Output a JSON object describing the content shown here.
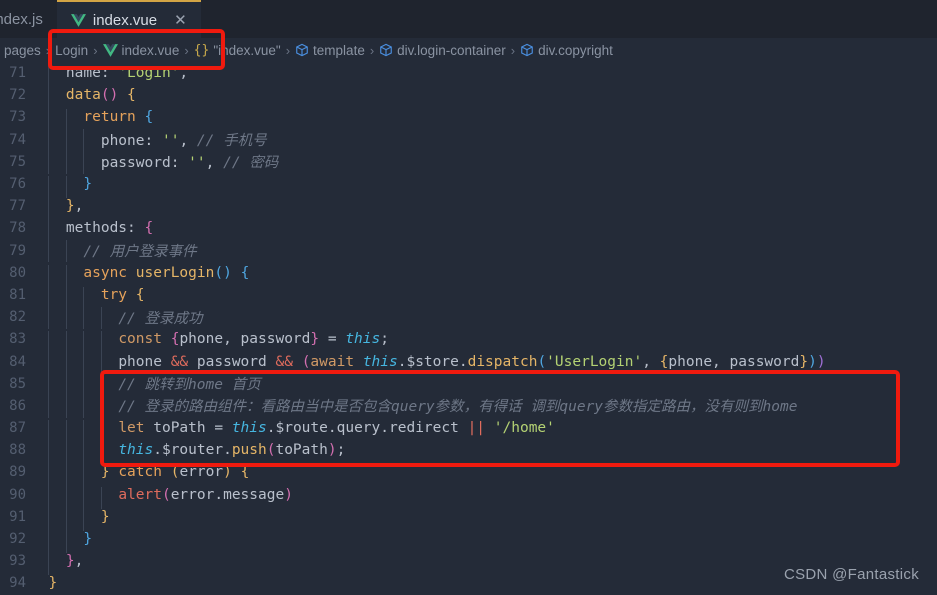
{
  "colors": {
    "editor_background": "#242b38",
    "tabbar_background": "#1f242e",
    "active_tab_accent": "#d3a545",
    "annotation_red": "#f01a0e",
    "gutter_text": "#545e70",
    "comment": "#6e7787",
    "string": "#b4d273",
    "keyword": "#c678dd",
    "vue_green": "#42b883",
    "vue_dark_green": "#35495e",
    "breadcrumb_icon_blue": "#4a8fe0"
  },
  "tabbar": {
    "tabs": [
      {
        "label": "index.js",
        "icon": "javascript-file-icon",
        "active": false,
        "closable": false
      },
      {
        "label": "index.vue",
        "icon": "vue-file-icon",
        "active": true,
        "closable": true,
        "close_glyph": "✕"
      }
    ]
  },
  "breadcrumb": {
    "items": [
      {
        "label": "pages",
        "icon": ""
      },
      {
        "label": "Login",
        "icon": ""
      },
      {
        "label": "index.vue",
        "icon": "vue-file-icon"
      },
      {
        "label": "\"index.vue\"",
        "icon": "braces-icon",
        "braces": "{}"
      },
      {
        "label": "template",
        "icon": "cube-icon"
      },
      {
        "label": "div.login-container",
        "icon": "cube-icon"
      },
      {
        "label": "div.copyright",
        "icon": "cube-icon"
      }
    ],
    "separator": "›"
  },
  "editor": {
    "first_line": 71,
    "lines": [
      {
        "n": "71",
        "indent": 2,
        "tokens": [
          {
            "t": "name",
            "c": "t-prop"
          },
          {
            "t": ": ",
            "c": "t-punc"
          },
          {
            "t": "'Login'",
            "c": "t-str"
          },
          {
            "t": ",",
            "c": "t-punc"
          }
        ]
      },
      {
        "n": "72",
        "indent": 2,
        "tokens": [
          {
            "t": "data",
            "c": "t-fn"
          },
          {
            "t": "()",
            "c": "t-brace-p"
          },
          {
            "t": " ",
            "c": "t-punc"
          },
          {
            "t": "{",
            "c": "t-brace-y"
          }
        ]
      },
      {
        "n": "73",
        "indent": 3,
        "tokens": [
          {
            "t": "return",
            "c": "t-kw2"
          },
          {
            "t": " ",
            "c": "t-punc"
          },
          {
            "t": "{",
            "c": "t-brace-b"
          }
        ]
      },
      {
        "n": "74",
        "indent": 4,
        "tokens": [
          {
            "t": "phone",
            "c": "t-prop"
          },
          {
            "t": ": ",
            "c": "t-punc"
          },
          {
            "t": "''",
            "c": "t-str"
          },
          {
            "t": ", ",
            "c": "t-punc"
          },
          {
            "t": "// 手机号",
            "c": "t-com"
          }
        ]
      },
      {
        "n": "75",
        "indent": 4,
        "tokens": [
          {
            "t": "password",
            "c": "t-prop"
          },
          {
            "t": ": ",
            "c": "t-punc"
          },
          {
            "t": "''",
            "c": "t-str"
          },
          {
            "t": ", ",
            "c": "t-punc"
          },
          {
            "t": "// 密码",
            "c": "t-com"
          }
        ]
      },
      {
        "n": "76",
        "indent": 3,
        "tokens": [
          {
            "t": "}",
            "c": "t-brace-b"
          }
        ]
      },
      {
        "n": "77",
        "indent": 2,
        "tokens": [
          {
            "t": "}",
            "c": "t-brace-y"
          },
          {
            "t": ",",
            "c": "t-punc"
          }
        ]
      },
      {
        "n": "78",
        "indent": 2,
        "tokens": [
          {
            "t": "methods",
            "c": "t-prop"
          },
          {
            "t": ": ",
            "c": "t-punc"
          },
          {
            "t": "{",
            "c": "t-brace-p"
          }
        ]
      },
      {
        "n": "79",
        "indent": 3,
        "tokens": [
          {
            "t": "// 用户登录事件",
            "c": "t-com"
          }
        ]
      },
      {
        "n": "80",
        "indent": 3,
        "tokens": [
          {
            "t": "async",
            "c": "t-kw2"
          },
          {
            "t": " ",
            "c": "t-punc"
          },
          {
            "t": "userLogin",
            "c": "t-fn"
          },
          {
            "t": "()",
            "c": "t-brace-b"
          },
          {
            "t": " ",
            "c": "t-punc"
          },
          {
            "t": "{",
            "c": "t-brace-b"
          }
        ]
      },
      {
        "n": "81",
        "indent": 4,
        "tokens": [
          {
            "t": "try",
            "c": "t-kw2"
          },
          {
            "t": " ",
            "c": "t-punc"
          },
          {
            "t": "{",
            "c": "t-brace-y"
          }
        ]
      },
      {
        "n": "82",
        "indent": 5,
        "tokens": [
          {
            "t": "// 登录成功",
            "c": "t-com"
          }
        ]
      },
      {
        "n": "83",
        "indent": 5,
        "tokens": [
          {
            "t": "const",
            "c": "t-var"
          },
          {
            "t": " ",
            "c": "t-punc"
          },
          {
            "t": "{",
            "c": "t-brace-p"
          },
          {
            "t": "phone, password",
            "c": "t-prop"
          },
          {
            "t": "}",
            "c": "t-brace-p"
          },
          {
            "t": " = ",
            "c": "t-punc"
          },
          {
            "t": "this",
            "c": "t-this"
          },
          {
            "t": ";",
            "c": "t-punc"
          }
        ]
      },
      {
        "n": "84",
        "indent": 5,
        "tokens": [
          {
            "t": "phone ",
            "c": "t-prop"
          },
          {
            "t": "&&",
            "c": "t-op"
          },
          {
            "t": " password ",
            "c": "t-prop"
          },
          {
            "t": "&&",
            "c": "t-op"
          },
          {
            "t": " ",
            "c": "t-punc"
          },
          {
            "t": "(",
            "c": "t-brace-p"
          },
          {
            "t": "await",
            "c": "t-var"
          },
          {
            "t": " ",
            "c": "t-punc"
          },
          {
            "t": "this",
            "c": "t-this"
          },
          {
            "t": ".",
            "c": "t-punc"
          },
          {
            "t": "$store",
            "c": "t-prop"
          },
          {
            "t": ".",
            "c": "t-punc"
          },
          {
            "t": "dispatch",
            "c": "t-fn"
          },
          {
            "t": "(",
            "c": "t-brace-b"
          },
          {
            "t": "'UserLogin'",
            "c": "t-str"
          },
          {
            "t": ", ",
            "c": "t-punc"
          },
          {
            "t": "{",
            "c": "t-brace-y"
          },
          {
            "t": "phone, password",
            "c": "t-prop"
          },
          {
            "t": "}",
            "c": "t-brace-y"
          },
          {
            "t": ")",
            "c": "t-brace-b"
          },
          {
            "t": ")",
            "c": "t-paren-v"
          }
        ]
      },
      {
        "n": "85",
        "indent": 5,
        "tokens": [
          {
            "t": "// 跳转到home 首页",
            "c": "t-com"
          }
        ]
      },
      {
        "n": "86",
        "indent": 5,
        "tokens": [
          {
            "t": "// 登录的路由组件：看路由当中是否包含query参数，有得话 调到query参数指定路由，没有则到home",
            "c": "t-com"
          }
        ]
      },
      {
        "n": "87",
        "indent": 5,
        "tokens": [
          {
            "t": "let",
            "c": "t-var"
          },
          {
            "t": " toPath ",
            "c": "t-prop"
          },
          {
            "t": "= ",
            "c": "t-punc"
          },
          {
            "t": "this",
            "c": "t-this"
          },
          {
            "t": ".",
            "c": "t-punc"
          },
          {
            "t": "$route",
            "c": "t-prop"
          },
          {
            "t": ".",
            "c": "t-punc"
          },
          {
            "t": "query",
            "c": "t-prop"
          },
          {
            "t": ".",
            "c": "t-punc"
          },
          {
            "t": "redirect",
            "c": "t-prop"
          },
          {
            "t": " ",
            "c": "t-punc"
          },
          {
            "t": "||",
            "c": "t-op"
          },
          {
            "t": " ",
            "c": "t-punc"
          },
          {
            "t": "'/home'",
            "c": "t-str"
          }
        ]
      },
      {
        "n": "88",
        "indent": 5,
        "tokens": [
          {
            "t": "this",
            "c": "t-this"
          },
          {
            "t": ".",
            "c": "t-punc"
          },
          {
            "t": "$router",
            "c": "t-prop"
          },
          {
            "t": ".",
            "c": "t-punc"
          },
          {
            "t": "push",
            "c": "t-fn"
          },
          {
            "t": "(",
            "c": "t-brace-p"
          },
          {
            "t": "toPath",
            "c": "t-prop"
          },
          {
            "t": ")",
            "c": "t-brace-p"
          },
          {
            "t": ";",
            "c": "t-punc"
          }
        ]
      },
      {
        "n": "89",
        "indent": 4,
        "tokens": [
          {
            "t": "}",
            "c": "t-brace-y"
          },
          {
            "t": " ",
            "c": "t-punc"
          },
          {
            "t": "catch",
            "c": "t-kw2"
          },
          {
            "t": " ",
            "c": "t-punc"
          },
          {
            "t": "(",
            "c": "t-brace-y"
          },
          {
            "t": "error",
            "c": "t-prop"
          },
          {
            "t": ")",
            "c": "t-brace-y"
          },
          {
            "t": " ",
            "c": "t-punc"
          },
          {
            "t": "{",
            "c": "t-brace-y"
          }
        ]
      },
      {
        "n": "90",
        "indent": 5,
        "tokens": [
          {
            "t": "alert",
            "c": "t-alert"
          },
          {
            "t": "(",
            "c": "t-brace-p"
          },
          {
            "t": "error",
            "c": "t-prop"
          },
          {
            "t": ".",
            "c": "t-punc"
          },
          {
            "t": "message",
            "c": "t-prop"
          },
          {
            "t": ")",
            "c": "t-brace-p"
          }
        ]
      },
      {
        "n": "91",
        "indent": 4,
        "tokens": [
          {
            "t": "}",
            "c": "t-brace-y"
          }
        ]
      },
      {
        "n": "92",
        "indent": 3,
        "tokens": [
          {
            "t": "}",
            "c": "t-brace-b"
          }
        ]
      },
      {
        "n": "93",
        "indent": 2,
        "tokens": [
          {
            "t": "}",
            "c": "t-brace-p"
          },
          {
            "t": ",",
            "c": "t-punc"
          }
        ]
      },
      {
        "n": "94",
        "indent": 1,
        "tokens": [
          {
            "t": "}",
            "c": "t-brace-y"
          }
        ]
      }
    ]
  },
  "annotations": [
    {
      "name": "breadcrumb-highlight",
      "color": "#f01a0e"
    },
    {
      "name": "code-highlight",
      "color": "#f01a0e"
    }
  ],
  "watermark": {
    "text": "CSDN @Fantastick"
  }
}
